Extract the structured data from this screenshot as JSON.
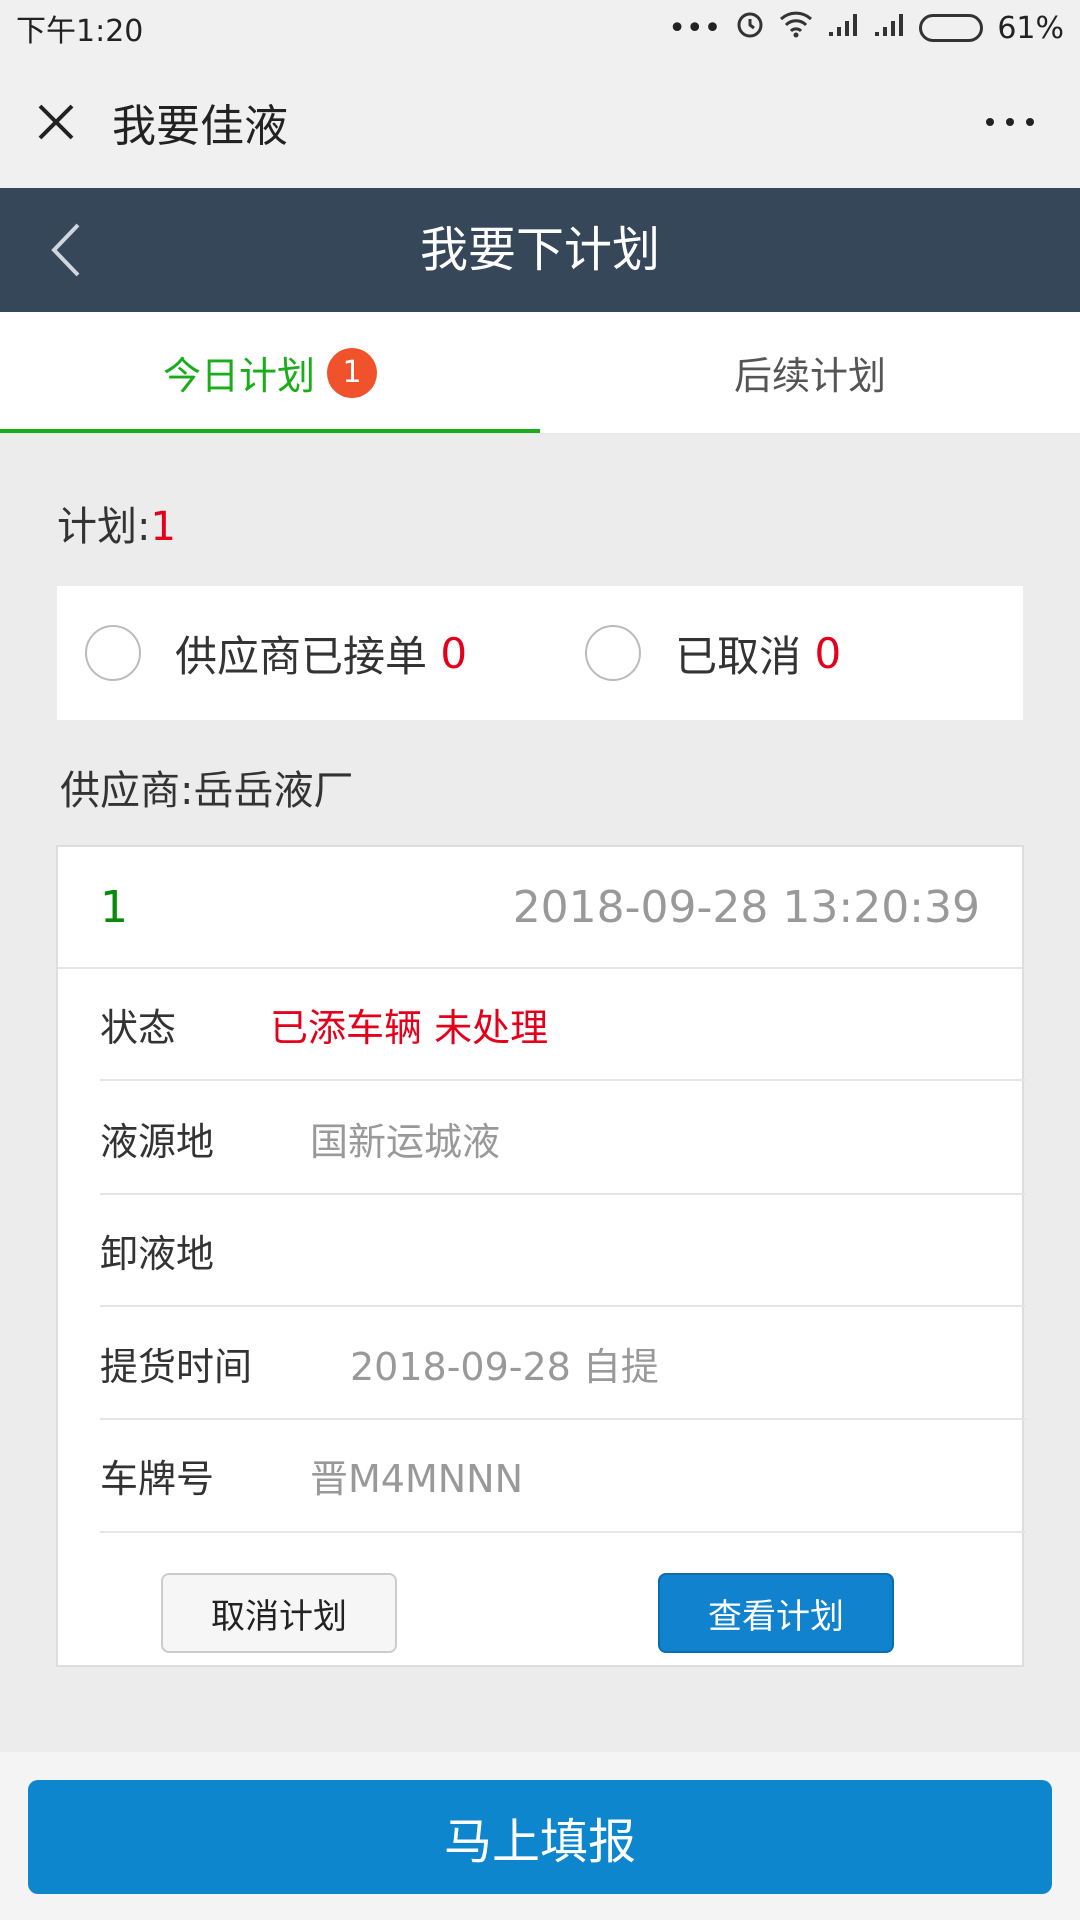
{
  "status_bar": {
    "time": "下午1:20",
    "battery": "61%",
    "battery_level": 0.61
  },
  "wechat_bar": {
    "title": "我要佳液"
  },
  "header": {
    "title": "我要下计划"
  },
  "tabs": [
    {
      "label": "今日计划",
      "badge": "1",
      "active": true
    },
    {
      "label": "后续计划",
      "active": false
    }
  ],
  "plan_summary": {
    "label": "计划:",
    "count": "1"
  },
  "filters": [
    {
      "label": "供应商已接单",
      "count": "0"
    },
    {
      "label": "已取消",
      "count": "0"
    }
  ],
  "supplier": "供应商:岳岳液厂",
  "card": {
    "number": "1",
    "datetime": "2018-09-28 13:20:39",
    "rows": [
      {
        "label": "状态",
        "value": "已添车辆 未处理"
      },
      {
        "label": "液源地",
        "value": "国新运城液"
      },
      {
        "label": "卸液地",
        "value": ""
      },
      {
        "label": "提货时间",
        "value": "2018-09-28 自提"
      },
      {
        "label": "车牌号",
        "value": "晋M4MNNN"
      }
    ],
    "cancel_label": "取消计划",
    "view_label": "查看计划"
  },
  "footer": {
    "submit_label": "马上填报"
  },
  "colors": {
    "header_bg": "#364759",
    "active_tab": "#1aad19",
    "primary_button": "#0e86ce",
    "alert_red": "#e4001b"
  }
}
